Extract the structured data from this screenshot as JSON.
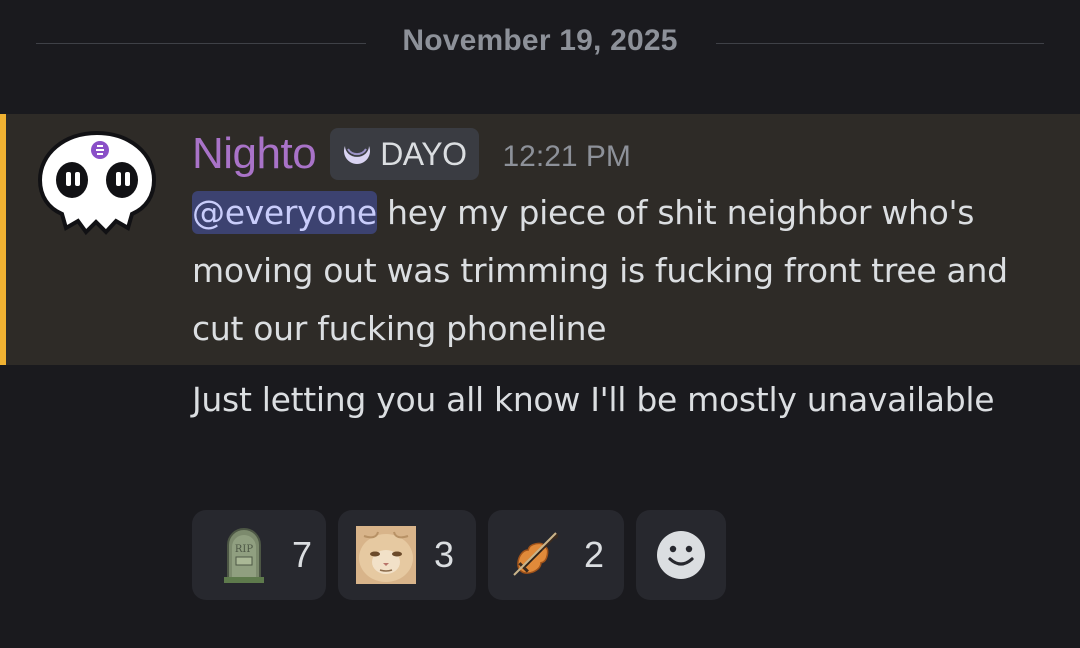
{
  "divider": {
    "date": "November 19, 2025"
  },
  "message": {
    "author": "Nighto",
    "author_color": "#a973c8",
    "tag": "DAYO",
    "tag_icon": "crescent-moon-icon",
    "timestamp": "12:21 PM",
    "mention": "@everyone",
    "first_text": " hey my piece of shit neighbor who's moving out was trimming is fucking front tree and cut our fucking phoneline",
    "second_text": "Just letting you all know I'll be mostly unavailable",
    "highlight_color": "#f0b232"
  },
  "reactions": [
    {
      "emoji": "tombstone-rip-emoji",
      "count": "7"
    },
    {
      "emoji": "cat-face-emoji",
      "count": "3"
    },
    {
      "emoji": "violin-emoji",
      "count": "2"
    }
  ],
  "add_reaction": {
    "icon": "smiley-add-reaction-icon"
  }
}
